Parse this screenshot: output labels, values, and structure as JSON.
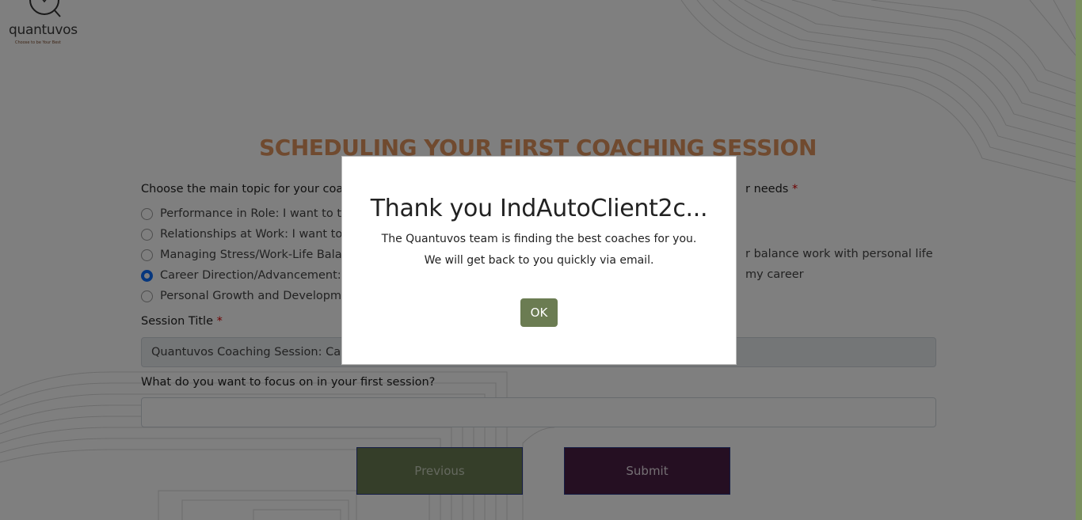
{
  "brand": {
    "name": "quantuvos",
    "tagline": "Choose to be Your Best"
  },
  "page": {
    "title": "SCHEDULING YOUR FIRST COACHING SESSION",
    "question_left": "Choose the main topic for your coach",
    "question_right": "r needs",
    "required_mark": "*",
    "topics": [
      {
        "label": "Performance in Role: I want to tall",
        "checked": false
      },
      {
        "label": "Relationships at Work: I want to ta",
        "checked": false
      },
      {
        "label": "Managing Stress/Work-Life Balar",
        "checked": false
      },
      {
        "label": "Career Direction/Advancement: I",
        "checked": true
      },
      {
        "label": "Personal Growth and Developmen",
        "checked": false
      }
    ],
    "topics_right": [
      "r balance work with personal life",
      "my career"
    ],
    "session_title_label": "Session Title",
    "session_title_value": "Quantuvos Coaching Session: Care",
    "focus_label": "What do you want to focus on in your first session?",
    "focus_value": "",
    "previous_label": "Previous",
    "submit_label": "Submit"
  },
  "modal": {
    "title": "Thank you IndAutoClient2c...",
    "line1": "The Quantuvos team is finding the best coaches for you.",
    "line2": "We will get back to you quickly via email.",
    "ok_label": "OK"
  },
  "colors": {
    "accent_title": "#e0955e",
    "primary_button": "#6b7c52",
    "submit_button": "#4a1f45",
    "radio_checked": "#0d6efd"
  }
}
